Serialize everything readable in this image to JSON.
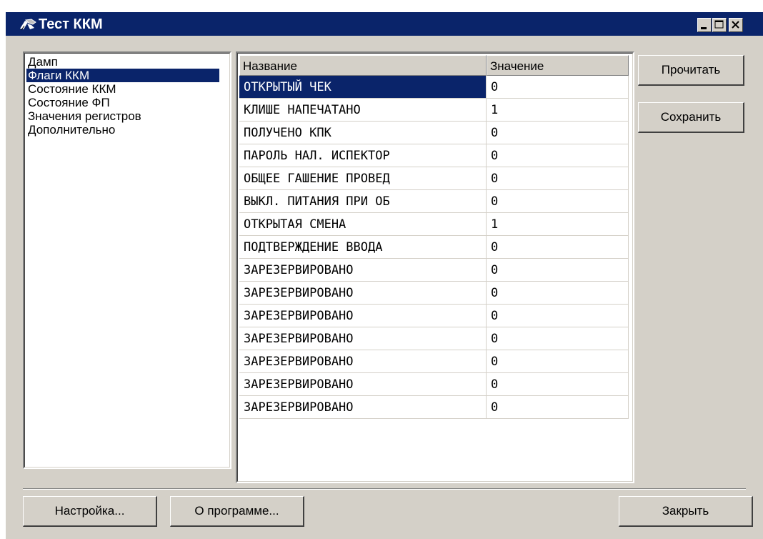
{
  "window": {
    "title": "Тест ККМ",
    "title_icon": "pen-hand-icon",
    "controls": [
      "minimize-icon",
      "maximize-icon",
      "close-icon"
    ]
  },
  "left_list": {
    "items": [
      {
        "label": "Дамп",
        "selected": false
      },
      {
        "label": "Флаги ККМ",
        "selected": true
      },
      {
        "label": "Состояние ККМ",
        "selected": false
      },
      {
        "label": "Состояние ФП",
        "selected": false
      },
      {
        "label": "Значения регистров",
        "selected": false
      },
      {
        "label": "Дополнительно",
        "selected": false
      }
    ]
  },
  "table": {
    "columns": [
      "Название",
      "Значение"
    ],
    "rows": [
      {
        "name": "ОТКРЫТЫЙ ЧЕК",
        "value": "0",
        "selected": true
      },
      {
        "name": "КЛИШЕ НАПЕЧАТАНО",
        "value": "1"
      },
      {
        "name": "ПОЛУЧЕНО КПК",
        "value": "0"
      },
      {
        "name": "ПАРОЛЬ НАЛ. ИСПЕКТОР",
        "value": "0"
      },
      {
        "name": "ОБЩЕЕ ГАШЕНИЕ ПРОВЕД",
        "value": "0"
      },
      {
        "name": "ВЫКЛ. ПИТАНИЯ ПРИ ОБ",
        "value": "0"
      },
      {
        "name": "ОТКРЫТАЯ СМЕНА",
        "value": "1"
      },
      {
        "name": "ПОДТВЕРЖДЕНИЕ ВВОДА",
        "value": "0"
      },
      {
        "name": "ЗАРЕЗЕРВИРОВАНО",
        "value": "0"
      },
      {
        "name": "ЗАРЕЗЕРВИРОВАНО",
        "value": "0"
      },
      {
        "name": "ЗАРЕЗЕРВИРОВАНО",
        "value": "0"
      },
      {
        "name": "ЗАРЕЗЕРВИРОВАНО",
        "value": "0"
      },
      {
        "name": "ЗАРЕЗЕРВИРОВАНО",
        "value": "0"
      },
      {
        "name": "ЗАРЕЗЕРВИРОВАНО",
        "value": "0"
      },
      {
        "name": "ЗАРЕЗЕРВИРОВАНО",
        "value": "0"
      }
    ]
  },
  "buttons": {
    "read": "Прочитать",
    "save": "Сохранить",
    "settings": "Настройка...",
    "about": "О программе...",
    "close": "Закрыть"
  },
  "colors": {
    "title_bar": "#0a246a",
    "face": "#d4d0c8",
    "selection": "#0a246a"
  }
}
